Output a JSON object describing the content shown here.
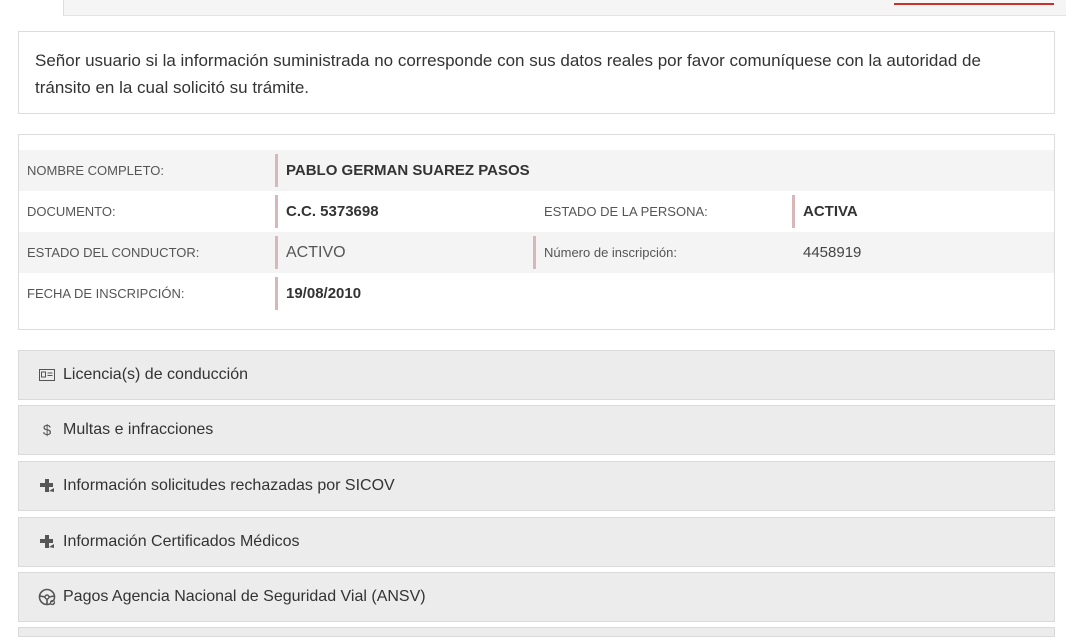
{
  "notice": {
    "text": "Señor usuario si la información suministrada no corresponde con sus datos reales por favor comuníquese con la autoridad de tránsito en la cual solicitó su trámite."
  },
  "person": {
    "nombre_label": "NOMBRE COMPLETO:",
    "nombre_value": "PABLO GERMAN SUAREZ PASOS",
    "documento_label": "DOCUMENTO:",
    "documento_value": "C.C. 5373698",
    "estado_persona_label": "ESTADO DE LA PERSONA:",
    "estado_persona_value": "ACTIVA",
    "estado_conductor_label": "ESTADO DEL CONDUCTOR:",
    "estado_conductor_value": "ACTIVO",
    "inscripcion_label": "Número de inscripción:",
    "inscripcion_value": "4458919",
    "fecha_label": "FECHA DE INSCRIPCIÓN:",
    "fecha_value": "19/08/2010"
  },
  "accordion": [
    {
      "icon": "id-card-icon",
      "label": "Licencia(s) de conducción"
    },
    {
      "icon": "dollar-icon",
      "label": "Multas e infracciones"
    },
    {
      "icon": "medical-plus-icon",
      "label": "Información solicitudes rechazadas por SICOV"
    },
    {
      "icon": "medical-plus-icon",
      "label": "Información Certificados Médicos"
    },
    {
      "icon": "steering-wheel-icon",
      "label": "Pagos Agencia Nacional de Seguridad Vial (ANSV)"
    }
  ]
}
